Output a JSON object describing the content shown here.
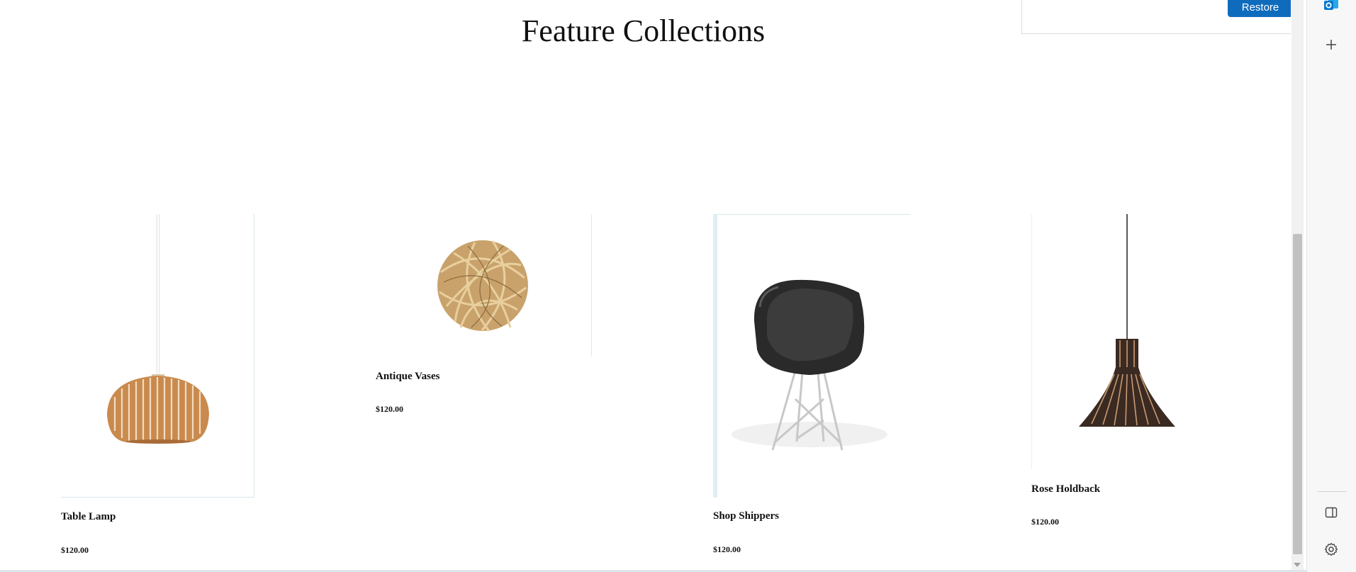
{
  "section": {
    "title": "Feature Collections"
  },
  "products": [
    {
      "name": "Table Lamp",
      "price": "$120.00",
      "image": "wooden-pendant-lamp"
    },
    {
      "name": "Antique Vases",
      "price": "$120.00",
      "image": "wicker-ball"
    },
    {
      "name": "Shop Shippers",
      "price": "$120.00",
      "image": "black-shell-chair"
    },
    {
      "name": "Rose Holdback",
      "price": "$120.00",
      "image": "dark-slatted-pendant"
    }
  ],
  "notification": {
    "restore_label": "Restore"
  },
  "sidebar": {
    "icons": [
      "outlook-icon",
      "plus-icon",
      "split-screen-icon",
      "settings-icon"
    ]
  },
  "colors": {
    "accent": "#0f6cbd",
    "outlook_blue": "#0078d4",
    "text": "#111111"
  }
}
